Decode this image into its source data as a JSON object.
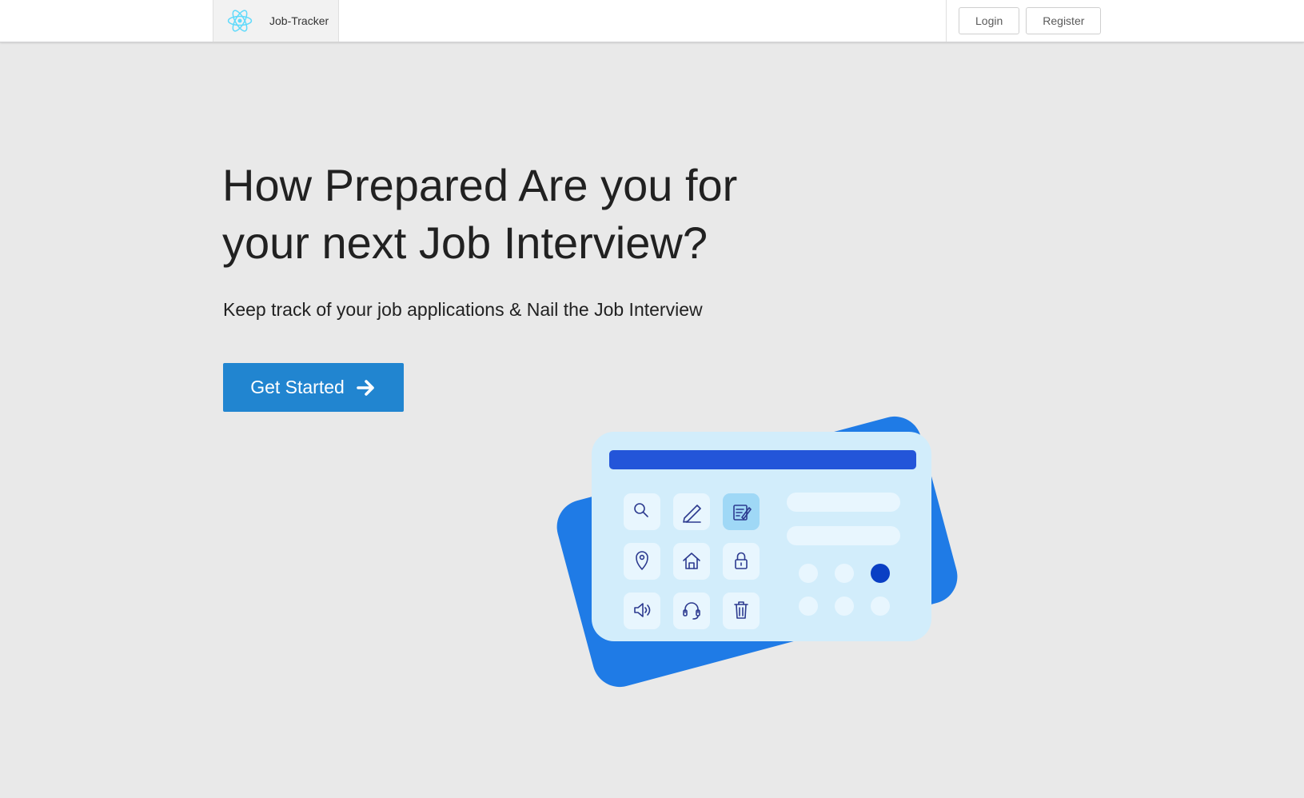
{
  "navbar": {
    "brand_name": "Job-Tracker",
    "brand_icon": "react-atom-icon",
    "login_label": "Login",
    "register_label": "Register"
  },
  "hero": {
    "title": "How Prepared Are you for your next Job Interview?",
    "subtitle": "Keep track of your job applications & Nail the Job Interview",
    "cta_label": "Get Started",
    "cta_icon": "arrow-right-icon"
  },
  "illustration": {
    "tiles": [
      "search-icon",
      "pen-icon",
      "edit-note-icon",
      "location-pin-icon",
      "home-icon",
      "lock-icon",
      "speaker-icon",
      "headset-icon",
      "trash-icon"
    ]
  },
  "colors": {
    "background": "#e9e9e9",
    "primary": "#2185d0",
    "card_back": "#1f7be6",
    "card_front": "#d2edfb",
    "header_bar": "#2355d9",
    "icon_stroke": "#2c3a8f"
  }
}
